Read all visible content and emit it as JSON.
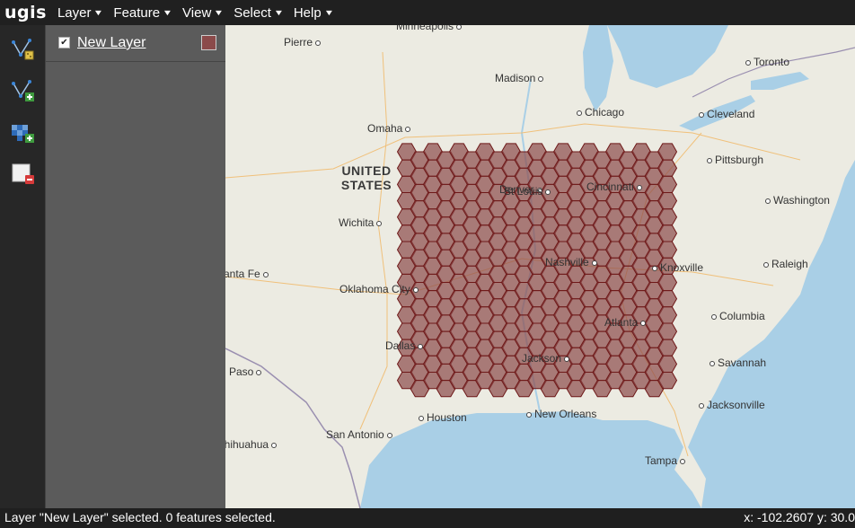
{
  "app": {
    "name": "ugis"
  },
  "menu": [
    {
      "label": "Layer"
    },
    {
      "label": "Feature"
    },
    {
      "label": "View"
    },
    {
      "label": "Select"
    },
    {
      "label": "Help"
    }
  ],
  "layers": [
    {
      "name": "New Layer",
      "checked": true,
      "color": "#8b4a4a"
    }
  ],
  "map": {
    "country_label": "UNITED STATES",
    "cities": [
      "Minneapolis",
      "Pierre",
      "Madison",
      "Toronto",
      "Omaha",
      "Chicago",
      "Cleveland",
      "Pittsburgh",
      "Denver",
      "St Louis",
      "Cincinnati",
      "Washington",
      "Wichita",
      "Nashville",
      "Knoxville",
      "Raleigh",
      "Santa Fe",
      "Oklahoma City",
      "Columbia",
      "Atlanta",
      "Dallas",
      "Jackson",
      "Savannah",
      "El Paso",
      "Houston",
      "New Orleans",
      "Jacksonville",
      "San Antonio",
      "Chihuahua",
      "Tampa"
    ],
    "hex_fill": "#8b4a4a",
    "hex_stroke": "#6e1818"
  },
  "status": {
    "message": "Layer \"New Layer\" selected. 0 features selected.",
    "coords": "x: -102.2607 y: 30.0"
  }
}
